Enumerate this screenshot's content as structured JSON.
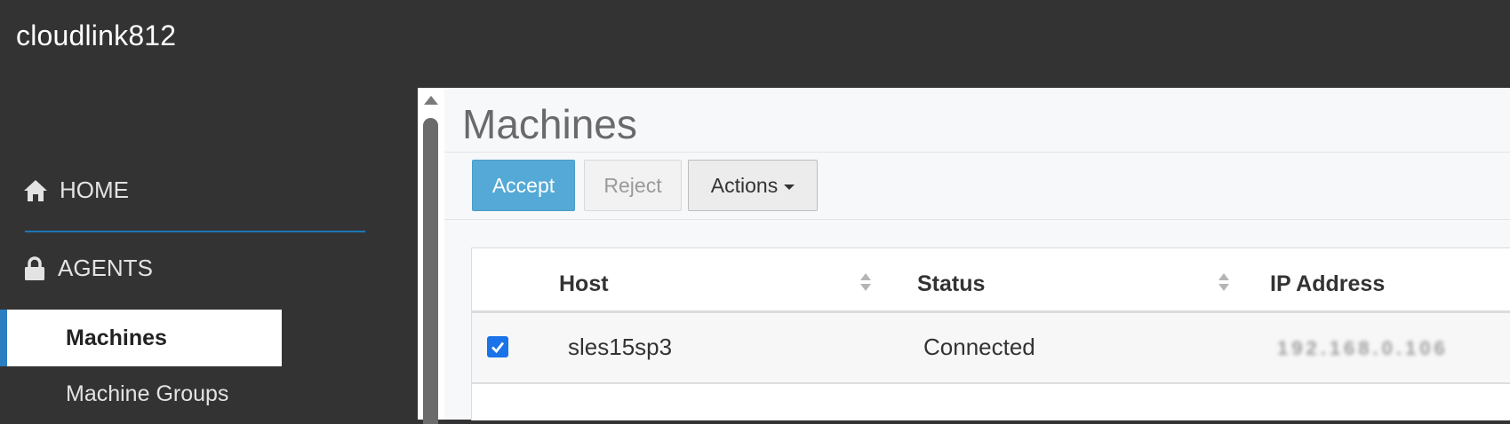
{
  "app": {
    "title": "cloudlink812"
  },
  "sidebar": {
    "sections": [
      {
        "label": "HOME",
        "icon": "home-icon"
      },
      {
        "label": "AGENTS",
        "icon": "lock-icon"
      }
    ],
    "items": [
      {
        "label": "Machines",
        "active": true
      },
      {
        "label": "Machine Groups",
        "active": false
      }
    ]
  },
  "page": {
    "title": "Machines"
  },
  "toolbar": {
    "accept_label": "Accept",
    "reject_label": "Reject",
    "actions_label": "Actions"
  },
  "table": {
    "columns": [
      "Host",
      "Status",
      "IP Address"
    ],
    "rows": [
      {
        "checked": true,
        "host": "sles15sp3",
        "status": "Connected",
        "ip": "192.168.0.106"
      }
    ]
  },
  "colors": {
    "accent": "#55a9d6",
    "active_border": "#2b7fc1",
    "checkbox": "#1a73e8",
    "sidebar_bg": "#333333"
  }
}
